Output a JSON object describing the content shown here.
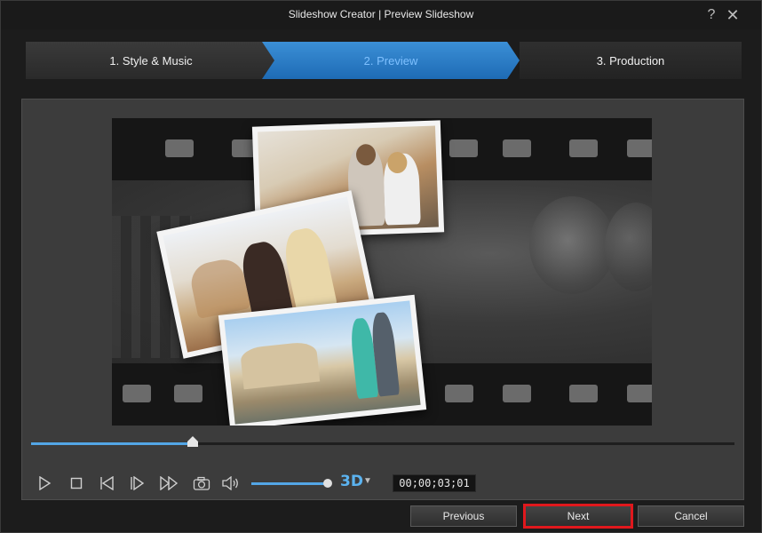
{
  "window": {
    "title": "Slideshow Creator | Preview Slideshow",
    "help_symbol": "?",
    "close_symbol": "✕"
  },
  "steps": [
    {
      "label": "1. Style & Music",
      "state": "done"
    },
    {
      "label": "2. Preview",
      "state": "active"
    },
    {
      "label": "3. Production",
      "state": "pending"
    }
  ],
  "preview": {
    "playback_position": 0.23,
    "volume_level": 1.0,
    "timecode": "00;00;03;01",
    "three_d_label": "3D"
  },
  "controls": {
    "icons": [
      "play-icon",
      "stop-icon",
      "previous-frame-icon",
      "next-frame-icon",
      "fast-forward-icon",
      "snapshot-icon",
      "volume-icon"
    ]
  },
  "buttons": {
    "previous": "Previous",
    "next": "Next",
    "cancel": "Cancel"
  },
  "colors": {
    "accent": "#3b8fd6",
    "highlight": "#e0181d"
  }
}
